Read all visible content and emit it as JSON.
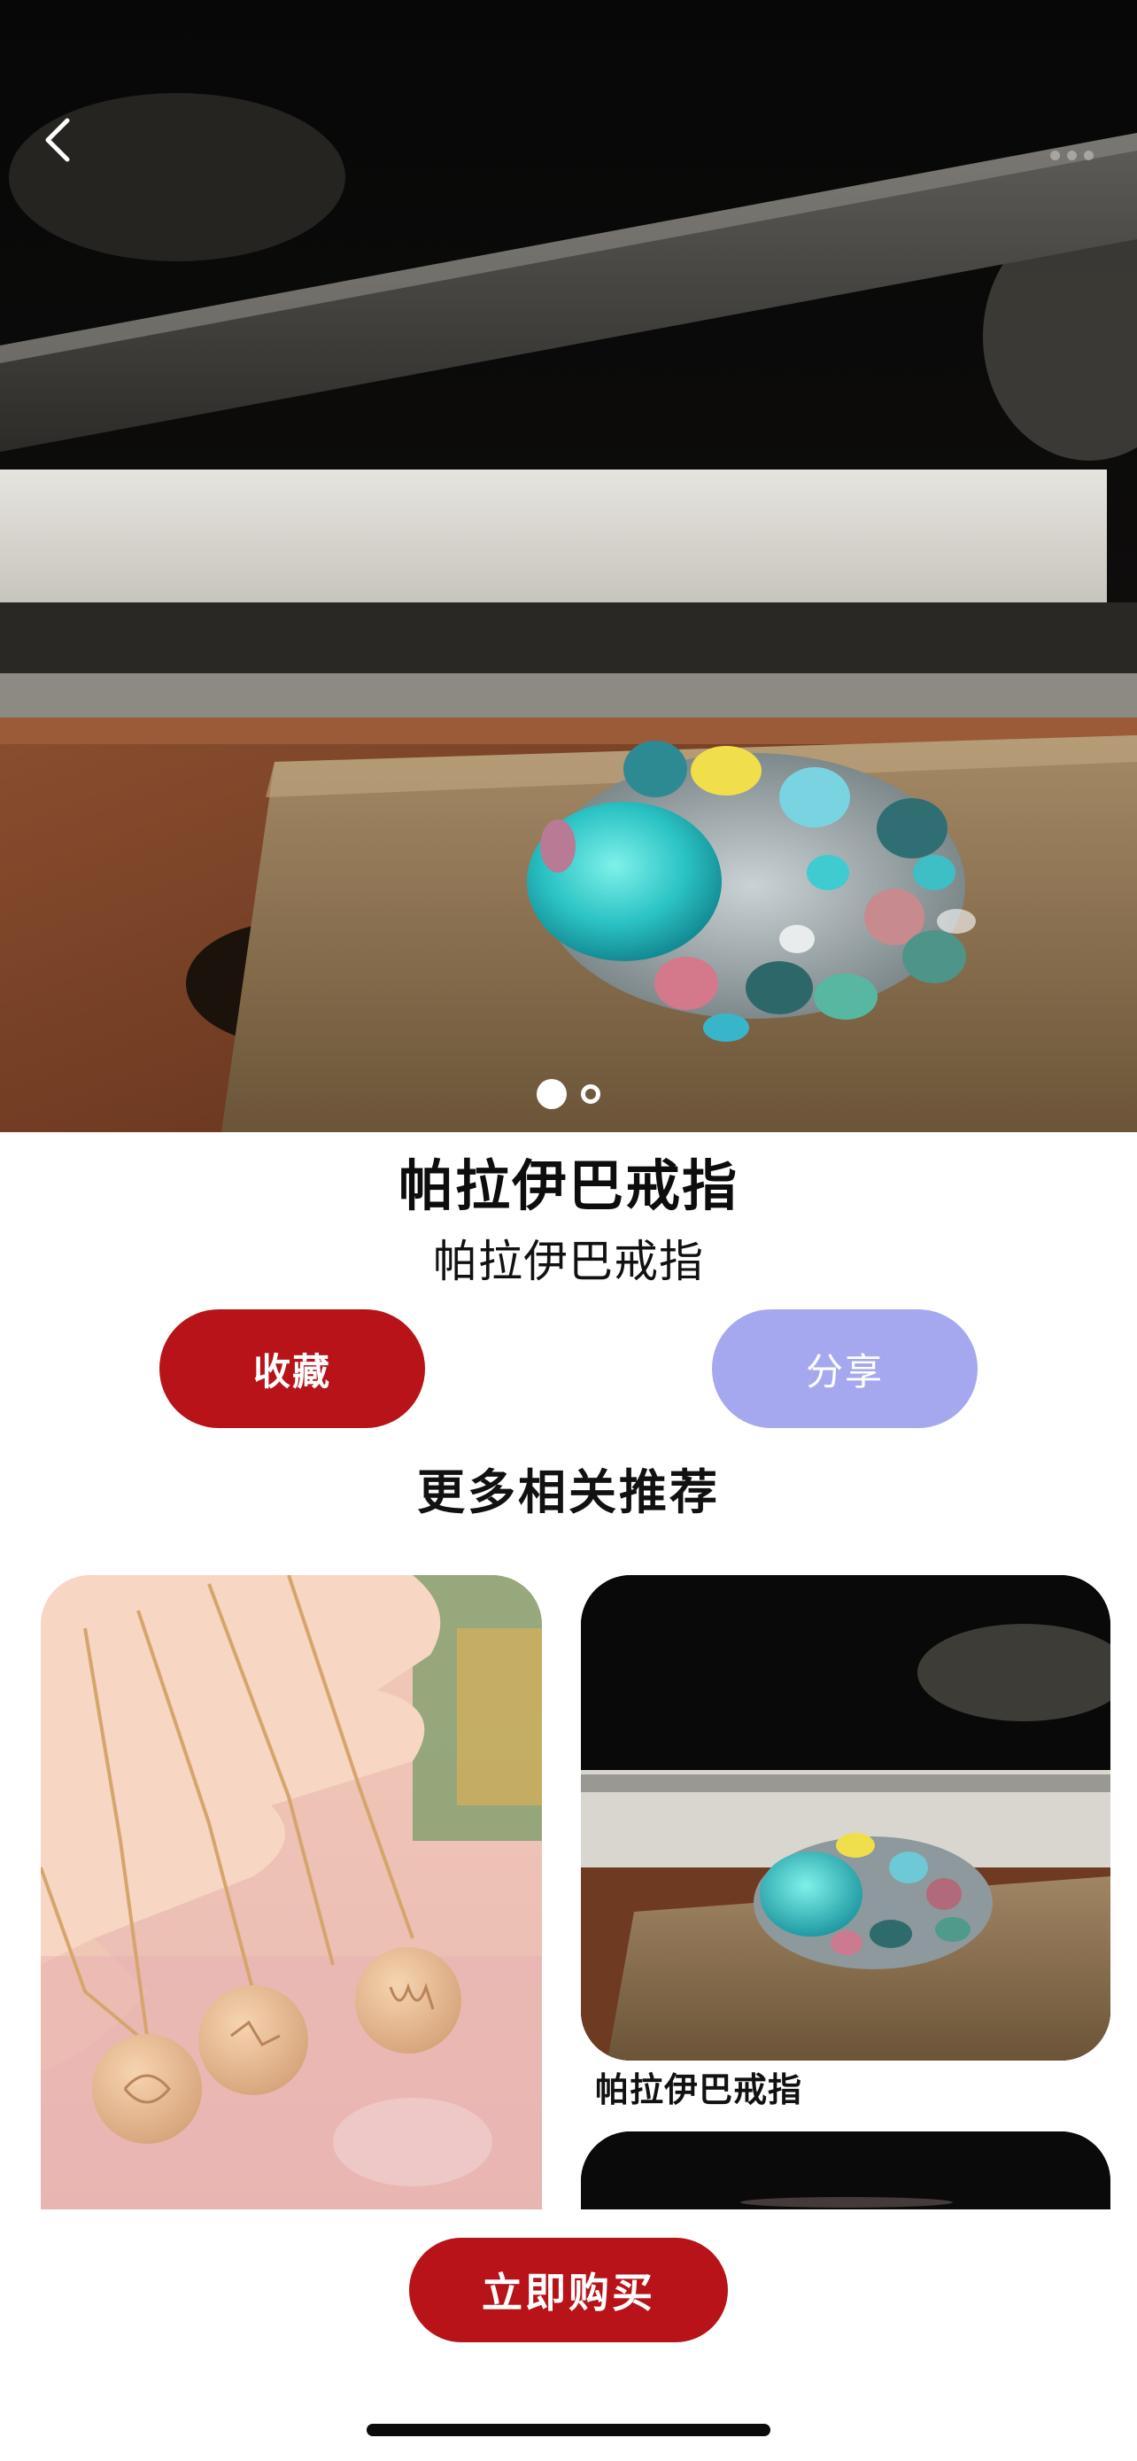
{
  "hero": {
    "image_alt": "ring-photo",
    "carousel": {
      "count": 2,
      "active": 0
    }
  },
  "product": {
    "title": "帕拉伊巴戒指",
    "subtitle": "帕拉伊巴戒指"
  },
  "actions": {
    "favorite_label": "收藏",
    "share_label": "分享"
  },
  "recommend": {
    "section_title": "更多相关推荐",
    "items": [
      {
        "caption": ""
      },
      {
        "caption": "帕拉伊巴戒指"
      },
      {
        "caption": ""
      }
    ]
  },
  "buy": {
    "label": "立即购买"
  },
  "colors": {
    "primary_red": "#b71318",
    "share_lavender": "#a6a8ef"
  },
  "icons": {
    "back": "chevron-left-icon",
    "more": "more-dots-icon"
  }
}
